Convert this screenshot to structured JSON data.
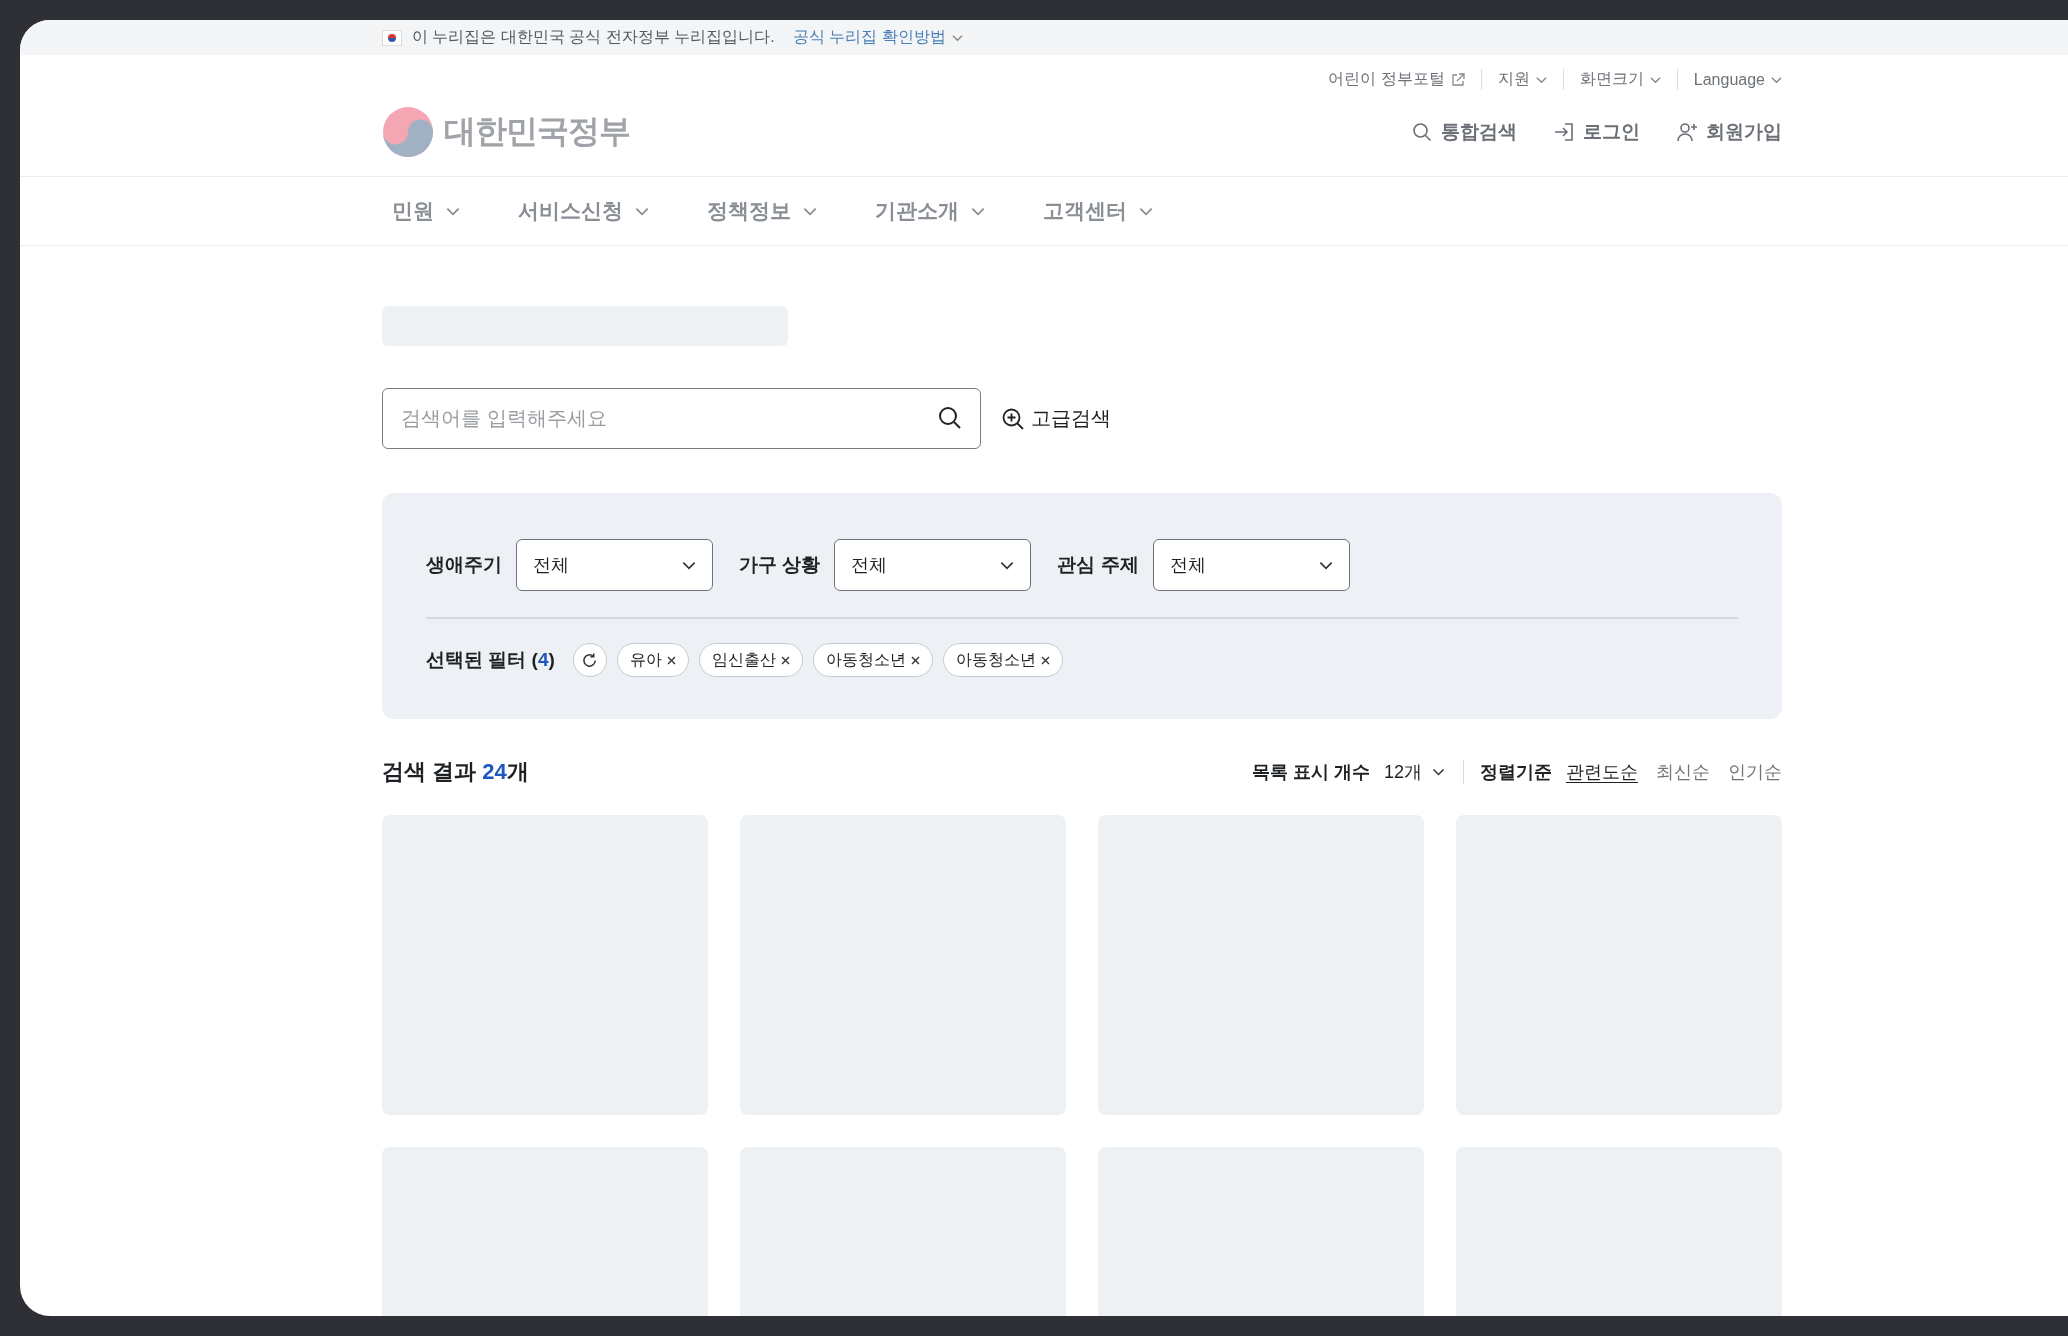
{
  "gov_banner": {
    "text": "이 누리집은 대한민국 공식 전자정부 누리집입니다.",
    "link": "공식 누리집 확인방법"
  },
  "utility_links": [
    {
      "label": "어린이 정부포털",
      "kind": "external"
    },
    {
      "label": "지원",
      "kind": "dropdown"
    },
    {
      "label": "화면크기",
      "kind": "dropdown"
    },
    {
      "label": "Language",
      "kind": "dropdown"
    }
  ],
  "logo": {
    "text": "대한민국정부"
  },
  "header_actions": [
    {
      "label": "통합검색",
      "kind": "search"
    },
    {
      "label": "로그인",
      "kind": "login"
    },
    {
      "label": "회원가입",
      "kind": "signup"
    }
  ],
  "nav": [
    {
      "label": "민원"
    },
    {
      "label": "서비스신청"
    },
    {
      "label": "정책정보"
    },
    {
      "label": "기관소개"
    },
    {
      "label": "고객센터"
    }
  ],
  "search": {
    "placeholder": "검색어를 입력해주세요",
    "advanced": "고급검색"
  },
  "filters": [
    {
      "label": "생애주기",
      "value": "전체"
    },
    {
      "label": "가구 상황",
      "value": "전체"
    },
    {
      "label": "관심 주제",
      "value": "전체"
    }
  ],
  "selected_filters": {
    "prefix": "선택된 필터 (",
    "count": "4",
    "suffix": ")",
    "chips": [
      "유아",
      "임신출산",
      "아동청소년",
      "아동청소년"
    ]
  },
  "results": {
    "prefix": "검색 결과 ",
    "count": "24",
    "suffix": "개",
    "page_size_label": "목록 표시 개수",
    "page_size": "12개",
    "sort_label": "정렬기준",
    "sort_options": [
      {
        "label": "관련도순",
        "selected": true
      },
      {
        "label": "최신순",
        "selected": false
      },
      {
        "label": "인기순",
        "selected": false
      }
    ]
  },
  "result_cards": [
    {
      "kind": "skeleton"
    },
    {
      "kind": "skeleton"
    },
    {
      "kind": "skeleton"
    },
    {
      "kind": "skeleton"
    },
    {
      "kind": "skeleton"
    },
    {
      "kind": "skeleton"
    },
    {
      "kind": "skeleton"
    },
    {
      "kind": "skeleton"
    }
  ]
}
